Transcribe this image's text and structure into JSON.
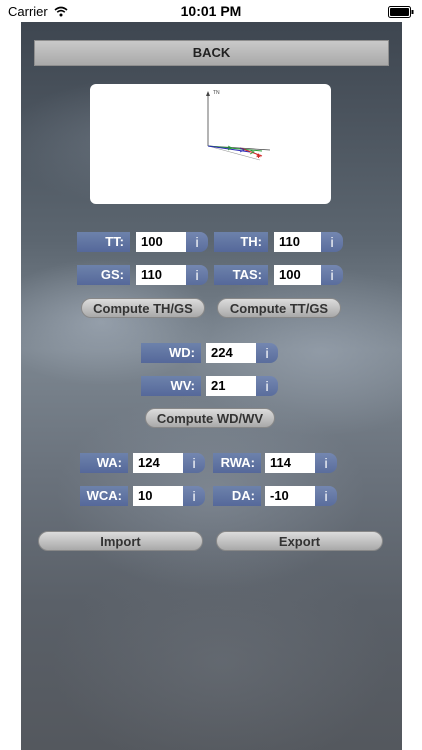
{
  "status_bar": {
    "carrier": "Carrier",
    "time": "10:01 PM"
  },
  "nav": {
    "back_label": "BACK"
  },
  "diagram": {
    "axis_label": "TN"
  },
  "heading_speed": {
    "tt": {
      "label": "TT:",
      "value": "100"
    },
    "th": {
      "label": "TH:",
      "value": "110"
    },
    "gs": {
      "label": "GS:",
      "value": "110"
    },
    "tas": {
      "label": "TAS:",
      "value": "100"
    },
    "compute_th_gs_label": "Compute TH/GS",
    "compute_tt_gs_label": "Compute TT/GS"
  },
  "wind": {
    "wd": {
      "label": "WD:",
      "value": "224"
    },
    "wv": {
      "label": "WV:",
      "value": "21"
    },
    "compute_label": "Compute WD/WV"
  },
  "angles": {
    "wa": {
      "label": "WA:",
      "value": "124"
    },
    "rwa": {
      "label": "RWA:",
      "value": "114"
    },
    "wca": {
      "label": "WCA:",
      "value": "10"
    },
    "da": {
      "label": "DA:",
      "value": "-10"
    }
  },
  "info_glyph": "i",
  "actions": {
    "import_label": "Import",
    "export_label": "Export"
  }
}
